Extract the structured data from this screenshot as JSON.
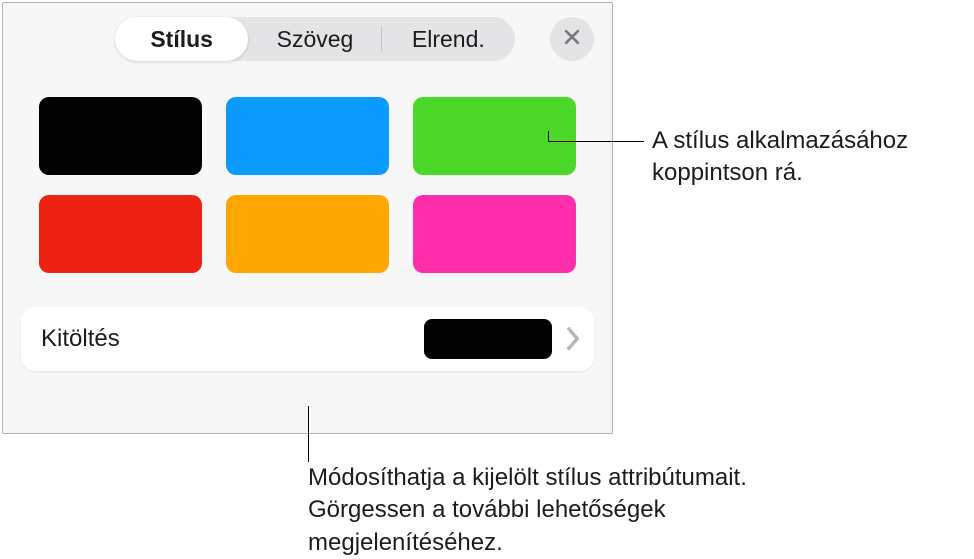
{
  "tabs": {
    "style": "Stílus",
    "text": "Szöveg",
    "arrange": "Elrend."
  },
  "swatches": [
    {
      "name": "black",
      "color": "#000000"
    },
    {
      "name": "blue",
      "color": "#0b9aff"
    },
    {
      "name": "green",
      "color": "#4cd82a"
    },
    {
      "name": "red",
      "color": "#ed2212"
    },
    {
      "name": "orange",
      "color": "#ffa600"
    },
    {
      "name": "magenta",
      "color": "#ff2eab"
    }
  ],
  "fill": {
    "label": "Kitöltés",
    "preview_color": "#000000"
  },
  "callouts": {
    "swatch": "A stílus alkalmazásához koppintson rá.",
    "fill": "Módosíthatja a kijelölt stílus attribútumait. Görgessen a további lehetőségek megjelenítéséhez."
  }
}
